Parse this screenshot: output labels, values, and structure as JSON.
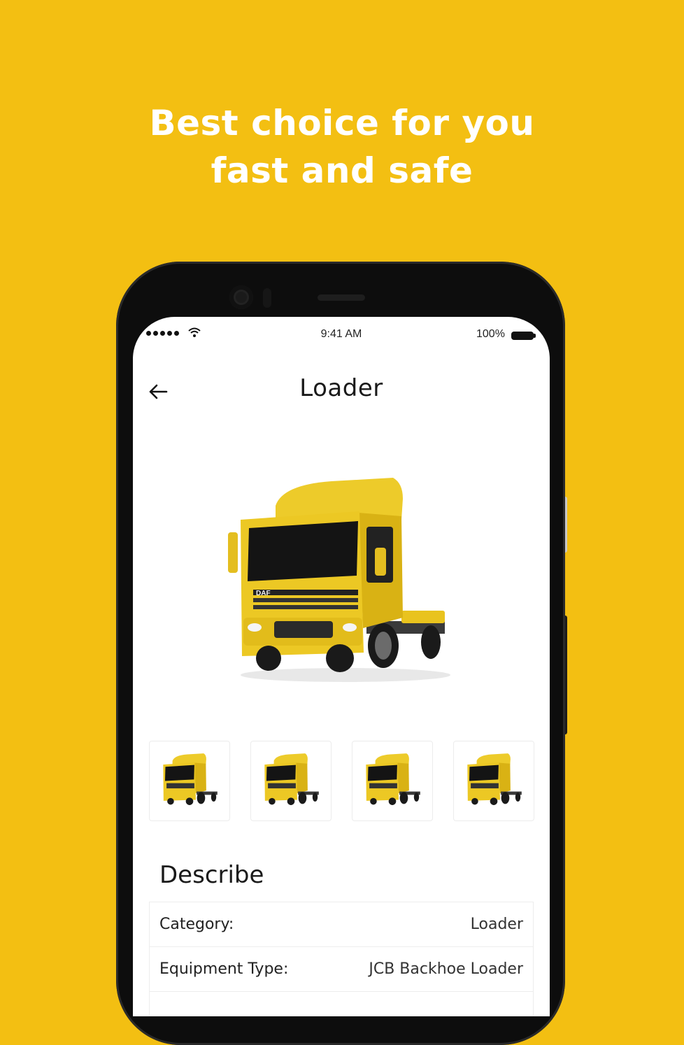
{
  "headline": {
    "line1": "Best choice for you",
    "line2": "fast and safe"
  },
  "status_bar": {
    "time": "9:41 AM",
    "battery": "100%"
  },
  "header": {
    "title": "Loader"
  },
  "thumbnails": [
    {
      "icon": "truck-thumbnail"
    },
    {
      "icon": "truck-thumbnail"
    },
    {
      "icon": "truck-thumbnail"
    },
    {
      "icon": "truck-thumbnail"
    }
  ],
  "describe": {
    "title": "Describe",
    "rows": [
      {
        "label": "Category:",
        "value": "Loader"
      },
      {
        "label": "Equipment Type:",
        "value": "JCB Backhoe Loader"
      }
    ]
  },
  "colors": {
    "background": "#F3BF12",
    "truck": "#E9C31E"
  }
}
